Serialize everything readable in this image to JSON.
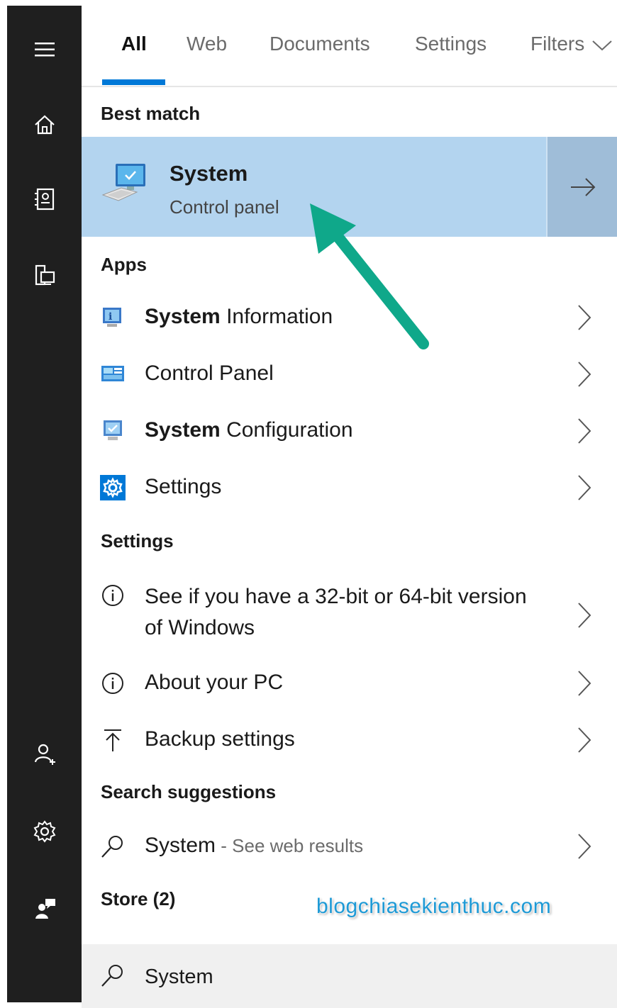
{
  "tabs": [
    {
      "label": "All",
      "active": true
    },
    {
      "label": "Web",
      "active": false
    },
    {
      "label": "Documents",
      "active": false
    },
    {
      "label": "Settings",
      "active": false
    },
    {
      "label": "Filters",
      "active": false
    }
  ],
  "best_match": {
    "heading": "Best match",
    "title": "System",
    "subtitle": "Control panel"
  },
  "apps": {
    "heading": "Apps",
    "items": [
      {
        "bold": "System",
        "rest": " Information",
        "icon": "system-information-icon"
      },
      {
        "bold": "",
        "rest": "Control Panel",
        "icon": "control-panel-icon"
      },
      {
        "bold": "System",
        "rest": " Configuration",
        "icon": "system-configuration-icon"
      },
      {
        "bold": "",
        "rest": "Settings",
        "icon": "settings-gear-icon"
      }
    ]
  },
  "settings": {
    "heading": "Settings",
    "items": [
      {
        "label": "See if you have a 32-bit or 64-bit version of Windows",
        "icon": "info-icon"
      },
      {
        "label": "About your PC",
        "icon": "info-icon"
      },
      {
        "label": "Backup settings",
        "icon": "upload-icon"
      }
    ]
  },
  "search_suggestions": {
    "heading": "Search suggestions",
    "query": "System",
    "hint": " - See web results"
  },
  "store": {
    "heading": "Store (2)"
  },
  "search_box": {
    "value": "System"
  },
  "watermark": "blogchiasekienthuc.com",
  "colors": {
    "accent": "#0078d7",
    "highlight": "#b3d4ef",
    "rail": "#1f1f1f",
    "annotation_arrow": "#0fa88a"
  }
}
